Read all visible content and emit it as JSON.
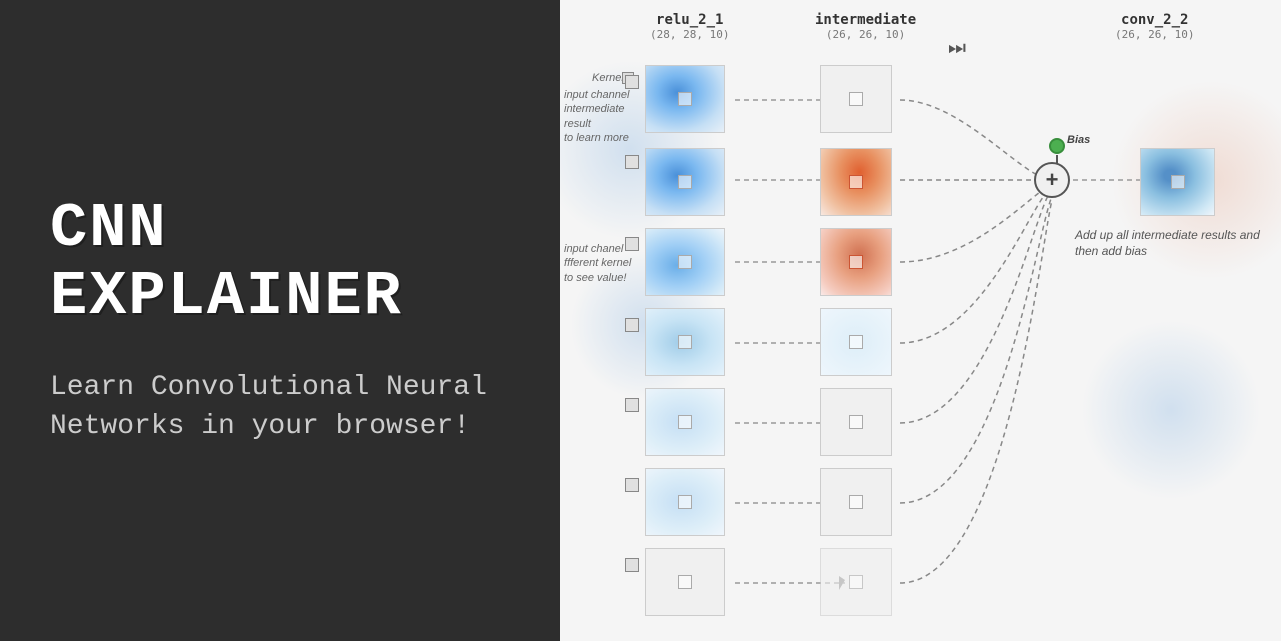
{
  "left": {
    "title": "CNN Explainer",
    "subtitle": "Learn Convolutional Neural Networks in your browser!"
  },
  "right": {
    "columns": [
      {
        "id": "relu_2_1",
        "name": "relu_2_1",
        "dims": "(28, 28, 10)"
      },
      {
        "id": "intermediate",
        "name": "intermediate",
        "dims": "(26, 26, 10)"
      },
      {
        "id": "conv_2_2",
        "name": "conv_2_2",
        "dims": "(26, 26, 10)"
      }
    ],
    "annotations": {
      "kernel": "Kernel",
      "input_channel": "input channel",
      "intermediate_result": "intermediate result",
      "learn_more": "to learn more",
      "input_channel2": "input chanel",
      "different_kernel": "fferent kernel",
      "see_value": "to see value!",
      "bias_label": "Bias",
      "add_description": "Add up all intermediate results and then add bias"
    }
  }
}
